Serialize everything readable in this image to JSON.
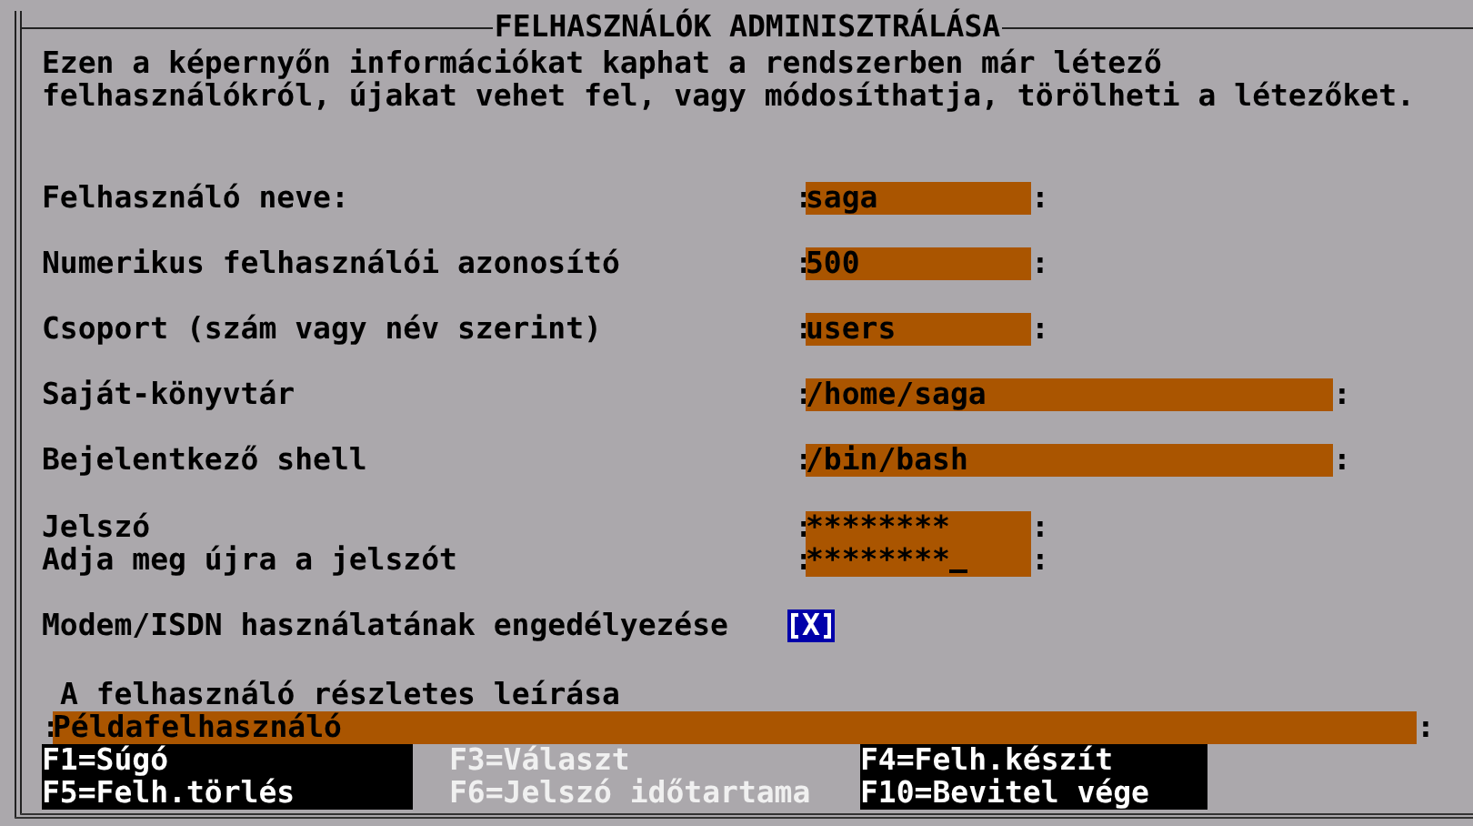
{
  "window": {
    "title": "FELHASZNÁLÓK ADMINISZTRÁLÁSA"
  },
  "intro": [
    "Ezen a képernyőn információkat kaphat a rendszerben már létező",
    "felhasználókról, újakat vehet fel, vagy módosíthatja, törölheti a létezőket."
  ],
  "fields": [
    {
      "label": "Felhasználó neve:",
      "open": ":",
      "value": "saga",
      "close": ":",
      "kind": "short"
    },
    {
      "label": "Numerikus felhasználói azonosító",
      "open": ":",
      "value": "500",
      "close": ":",
      "kind": "short"
    },
    {
      "label": "Csoport (szám vagy név szerint)",
      "open": ":",
      "value": "users",
      "close": ":",
      "kind": "short"
    },
    {
      "label": "Saját-könyvtár",
      "open": ":",
      "value": "/home/saga",
      "close": ":",
      "kind": "long"
    },
    {
      "label": "Bejelentkező shell",
      "open": ":",
      "value": "/bin/bash",
      "close": ":",
      "kind": "long"
    }
  ],
  "passwords": [
    {
      "label": "Jelszó",
      "open": ":",
      "value": "********",
      "close": ":",
      "cursor": false
    },
    {
      "label": "Adja meg újra a jelszót",
      "open": ":",
      "value": "********",
      "close": ":",
      "cursor": true
    }
  ],
  "checkbox": {
    "label": "Modem/ISDN használatának engedélyezése",
    "checked": true,
    "mark": "X",
    "focused": true
  },
  "description": {
    "label": "A felhasználó részletes leírása",
    "open": ":",
    "value": "Példafelhasználó",
    "close": ":"
  },
  "function_keys": [
    {
      "label": "F1=Súgó",
      "disabled": false
    },
    {
      "label": "F3=Választ",
      "disabled": true
    },
    {
      "label": "F4=Felh.készít",
      "disabled": false
    },
    {
      "label": "F5=Felh.törlés",
      "disabled": false
    },
    {
      "label": "F6=Jelszó időtartama",
      "disabled": true
    },
    {
      "label": "F10=Bevitel vége",
      "disabled": false
    }
  ]
}
